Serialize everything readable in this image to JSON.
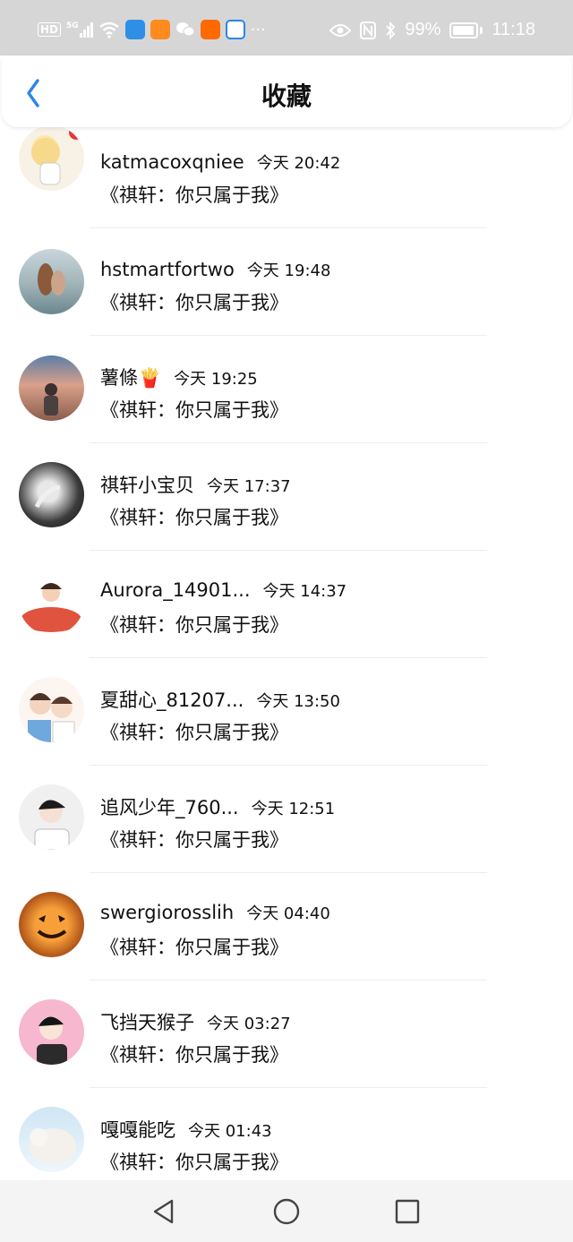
{
  "status_bar": {
    "network_badge": "HD",
    "signal": "5G",
    "more": "···",
    "battery": "99%",
    "time": "11:18"
  },
  "header": {
    "title": "收藏"
  },
  "items": [
    {
      "name": "katmacoxqniee",
      "time": "今天 20:42",
      "subtitle": "《祺轩：你只属于我》"
    },
    {
      "name": "hstmartfortwo",
      "time": "今天 19:48",
      "subtitle": "《祺轩：你只属于我》"
    },
    {
      "name": "薯條🍟",
      "time": "今天 19:25",
      "subtitle": "《祺轩：你只属于我》"
    },
    {
      "name": "祺轩小宝贝",
      "time": "今天 17:37",
      "subtitle": "《祺轩：你只属于我》"
    },
    {
      "name": "Aurora_14901...",
      "time": "今天 14:37",
      "subtitle": "《祺轩：你只属于我》"
    },
    {
      "name": "夏甜心_81207...",
      "time": "今天 13:50",
      "subtitle": "《祺轩：你只属于我》"
    },
    {
      "name": "追风少年_760...",
      "time": "今天 12:51",
      "subtitle": "《祺轩：你只属于我》"
    },
    {
      "name": "swergiorosslih",
      "time": "今天 04:40",
      "subtitle": "《祺轩：你只属于我》"
    },
    {
      "name": "飞挡天猴子",
      "time": "今天 03:27",
      "subtitle": "《祺轩：你只属于我》"
    },
    {
      "name": "嘎嘎能吃",
      "time": "今天 01:43",
      "subtitle": "《祺轩：你只属于我》"
    }
  ],
  "colors": {
    "accent": "#2a86e8",
    "status_bar": "#d6d6d6",
    "nav_bar": "#f4f4f4"
  }
}
